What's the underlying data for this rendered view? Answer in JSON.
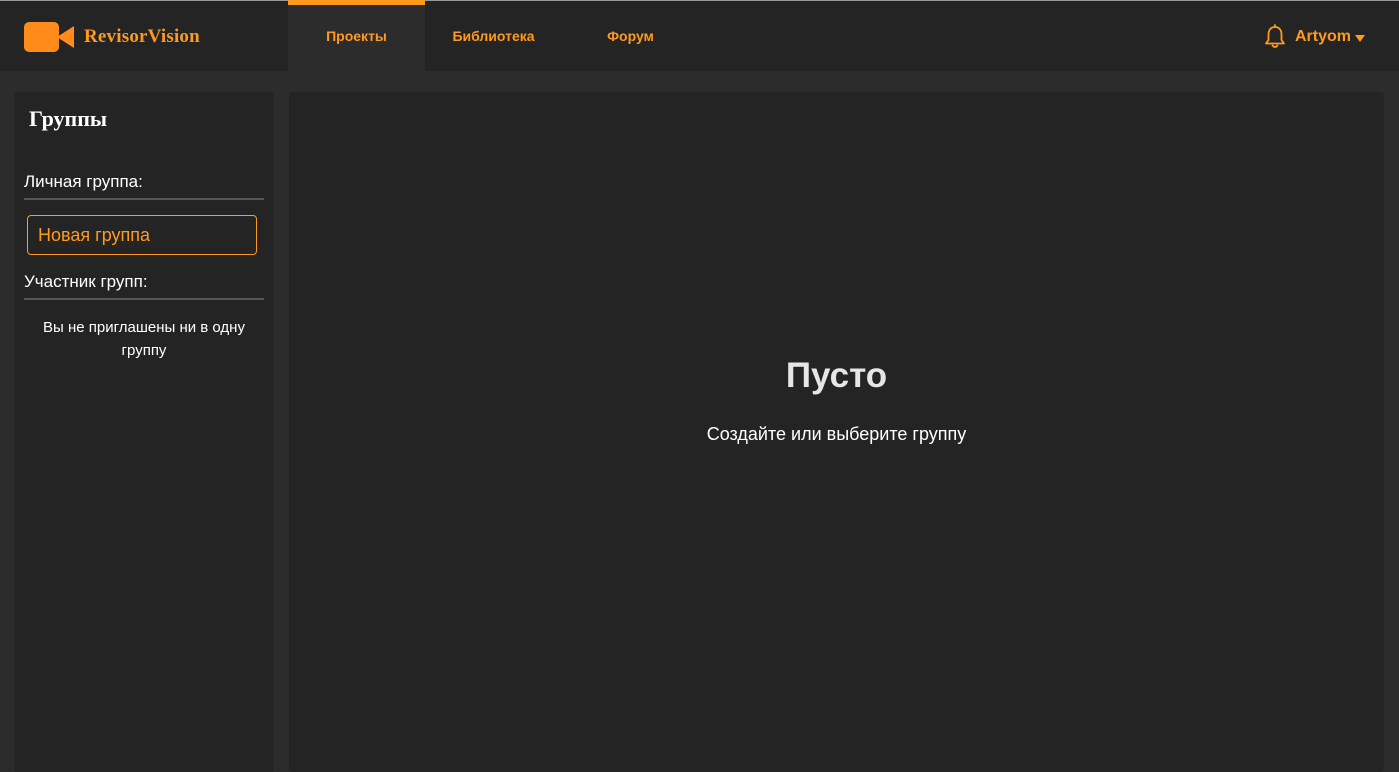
{
  "header": {
    "brand_name": "RevisorVision",
    "brand_icon": "video-camera-icon",
    "nav_tabs": [
      {
        "label": "Проекты",
        "active": true
      },
      {
        "label": "Библиотека",
        "active": false
      },
      {
        "label": "Форум",
        "active": false
      }
    ],
    "user": {
      "name": "Artyom",
      "notification_icon": "bell-icon",
      "menu_icon": "caret-down-icon"
    }
  },
  "sidebar": {
    "title": "Группы",
    "personal_group_label": "Личная группа:",
    "new_group_label": "Новая группа",
    "member_groups_label": "Участник групп:",
    "no_invites_text": "Вы не приглашены ни в одну группу"
  },
  "main": {
    "empty_title": "Пусто",
    "empty_subtitle": "Создайте или выберите группу"
  },
  "colors": {
    "accent": "#ff9a1f",
    "header_bg": "#242424",
    "panel_bg": "#242424",
    "page_bg": "#2c2c2c",
    "text": "#ffffff"
  }
}
